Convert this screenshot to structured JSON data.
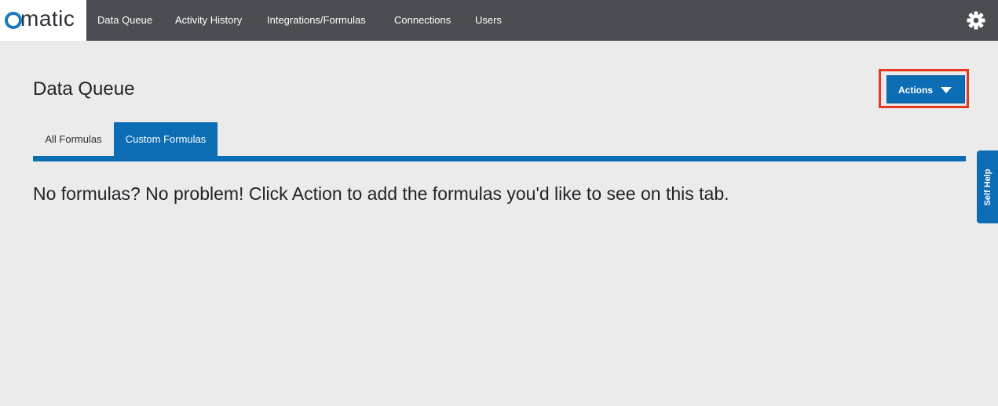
{
  "brand": {
    "logo_text": "matic",
    "accent": "#1a79bf"
  },
  "nav": {
    "items": [
      {
        "label": "Data Queue"
      },
      {
        "label": "Activity History"
      },
      {
        "label": "Integrations/Formulas"
      },
      {
        "label": "Connections"
      },
      {
        "label": "Users"
      }
    ],
    "settings_icon": "gear-icon"
  },
  "page": {
    "title": "Data Queue"
  },
  "actions": {
    "label": "Actions",
    "icon": "chevron-down-icon"
  },
  "tabs": [
    {
      "label": "All Formulas",
      "active": false
    },
    {
      "label": "Custom Formulas",
      "active": true
    }
  ],
  "empty_state": {
    "message": "No formulas? No problem! Click Action to add the formulas you'd like to see on this tab."
  },
  "self_help": {
    "label": "Self Help"
  },
  "colors": {
    "topbar": "#4a4d52",
    "primary": "#0c6db5",
    "highlight": "#e8371f",
    "background": "#ebebeb"
  }
}
